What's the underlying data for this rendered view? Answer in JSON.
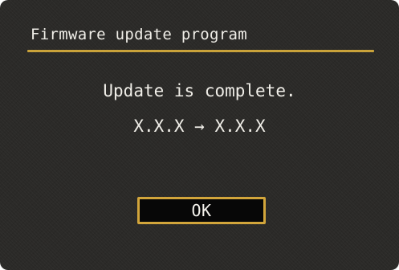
{
  "dialog": {
    "title": "Firmware update program",
    "message": "Update is complete.",
    "version_line": "X.X.X → X.X.X",
    "ok_label": "OK"
  },
  "colors": {
    "background": "#2b2a28",
    "accent": "#c9a23a",
    "button_fill": "#070707",
    "text": "#f0eee8"
  }
}
